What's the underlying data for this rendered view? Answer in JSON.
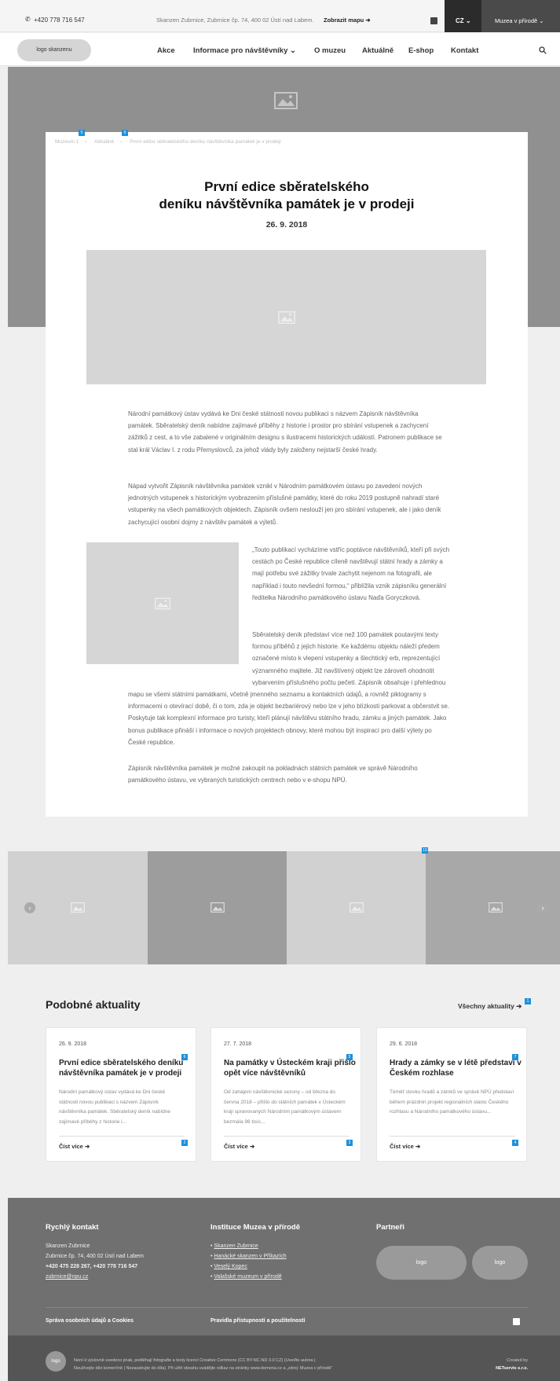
{
  "topbar": {
    "phone": "+420 778 716 547",
    "address": "Skanzen Zubrnice, Zubrnice čp. 74, 400 02 Ústí nad Labem.",
    "map_link": "Zobrazit mapu",
    "language": "CZ",
    "muzea_label": "Muzea v přírodě"
  },
  "nav": {
    "logo": "logo skanzenu",
    "items": [
      "Akce",
      "Informace pro návštěvníky",
      "O muzeu",
      "Aktuálně",
      "E-shop",
      "Kontakt"
    ]
  },
  "breadcrumb": {
    "items": [
      "Muzeum 1",
      "Aktuálně",
      "První edice sběratelského deníku návštěvníka památek je v prodeji"
    ],
    "badges": [
      "5",
      "6"
    ]
  },
  "article": {
    "title_line1": "První edice sběratelského",
    "title_line2": "deníku návštěvníka památek je v prodeji",
    "date": "26. 9. 2018",
    "paragraphs": [
      "Národní památkový ústav vydává ke Dni české státnosti novou publikaci s názvem Zápisník návštěvníka památek. Sběratelský deník nabídne zajímavé příběhy z historie i prostor pro sbírání vstupenek a zachycení zážitků z cest, a to vše zabalené v originálním designu s ilustracemi historických událostí. Patronem publikace se stal král Václav I. z rodu Přemyslovců, za jehož vlády byly založeny nejstarší české hrady.",
      "Nápad vytvořit Zápisník návštěvníka památek vznikl v Národním památkovém ústavu po zavedení nových jednotných vstupenek s historickým vyobrazením příslušné památky, které do roku 2019 postupně nahradí staré vstupenky na všech památkových objektech. Zápisník ovšem neslouží jen pro sbírání vstupenek, ale i jako deník zachycující osobní dojmy z návštěv památek a výletů.",
      "„Touto publikací vycházíme vstříc poptávce návštěvníků, kteří při svých cestách po České republice cíleně navštěvují státní hrady a zámky a mají potřebu své zážitky trvale zachytit nejenom na fotografii, ale například i touto nevšední formou,“ přiblížila vznik zápisníku generální ředitelka Národního památkového ústavu Naďa Goryczková.",
      "Sběratelský deník představí více než 100 památek poutavými texty formou příběhů z jejich historie. Ke každému objektu náleží předem označené místo k vlepení vstupenky a šlechtický erb, reprezentující významného majitele. Již navštívený objekt lze zároveň ohodnotit vybarvením příslušného počtu pečetí. Zápisník obsahuje i přehlednou mapu se všemi státními památkami, včetně jmenného seznamu a kontaktních údajů, a rovněž piktogramy s informacemi o otevírací době, či o tom, zda je objekt bezbariérový nebo lze v jeho blízkosti parkovat a občerstvit se. Poskytuje tak komplexní informace pro turisty, kteří plánují návštěvu státního hradu, zámku a jiných památek. Jako bonus publikace přináší i informace o nových projektech obnovy, které mohou být inspirací pro další výlety po České republice.",
      "Zápisník návštěvníka památek je možné zakoupit na pokladnách státních památek ve správě Národního památkového ústavu, ve vybraných turistických centrech nebo v e-shopu NPÚ."
    ]
  },
  "slider": {
    "badge": "10",
    "prev": "‹",
    "next": "›"
  },
  "news": {
    "title": "Podobné aktuality",
    "all_link": "Všechny aktuality",
    "all_badge": "1",
    "items": [
      {
        "date": "26. 9. 2018",
        "title": "První edice sběratelského deníku návštěvníka památek je v prodeji",
        "text": "Národní památkový ústav vydává ke Dni české státnosti novou publikaci s názvem Zápisník návštěvníka památek. Sběratelský deník nabídne zajímavé příběhy z historie i...",
        "more": "Číst více",
        "badge_title": "6",
        "badge_more": "2"
      },
      {
        "date": "27. 7. 2018",
        "title": "Na památky v Ústeckém kraji přišlo opět více návštěvníků",
        "text": "Od zahájení návštěvnické sezony – od března do června 2018 – přišlo do státních památek v Ústeckém kraji spravovaných Národním památkovým ústavem bezmála 96 tisíc...",
        "more": "Číst více",
        "badge_title": "5",
        "badge_more": "3"
      },
      {
        "date": "29. 6. 2018",
        "title": "Hrady a zámky se v létě představí v Českém rozhlase",
        "text": "Téměř stovku hradů a zámků ve správě NPÚ představí během prázdnin projekt regionálních stanic Českého rozhlasu a Národního památkového ústavu...",
        "more": "Číst více",
        "badge_title": "7",
        "badge_more": "4"
      }
    ]
  },
  "footer": {
    "contact_title": "Rychlý kontakt",
    "contact_lines": [
      "Skanzen Zubrnice",
      "Zubrnice čp. 74, 400 02 Ústí nad Labem",
      "+420 475 228 267, +420 778 716 547",
      "zubrnice@npu.cz"
    ],
    "institutions_title": "Instituce Muzea v přírodě",
    "institutions": [
      "Skanzen Zubrnice",
      "Hanácké skanzen v Příkazích",
      "Veselý Kopec",
      "Valašské muzeum v přírodě"
    ],
    "partners_title": "Partneři",
    "partner_logos": [
      "logo",
      "logo"
    ],
    "privacy_link": "Správa osobních údajů a Cookies",
    "access_link": "Pravidla přístupnosti a použitelnosti",
    "bottom_logo": "logo",
    "license_line1": "Není-li výslovně uvedeno jinak, podléhají fotografie a texty licenci Creative Commons (CC BY-NC-ND 3.0 CZ) (Uveďte autora |",
    "license_line2": "Neužívejte dílo komerčně | Nezasahujte do díla). Při užití obsahu uvádějte odkaz na stránky www.domena.cz a „zdroj: Muzea v přírodě“",
    "created_by": "Created by",
    "created_company": "NETservis s.r.o."
  }
}
